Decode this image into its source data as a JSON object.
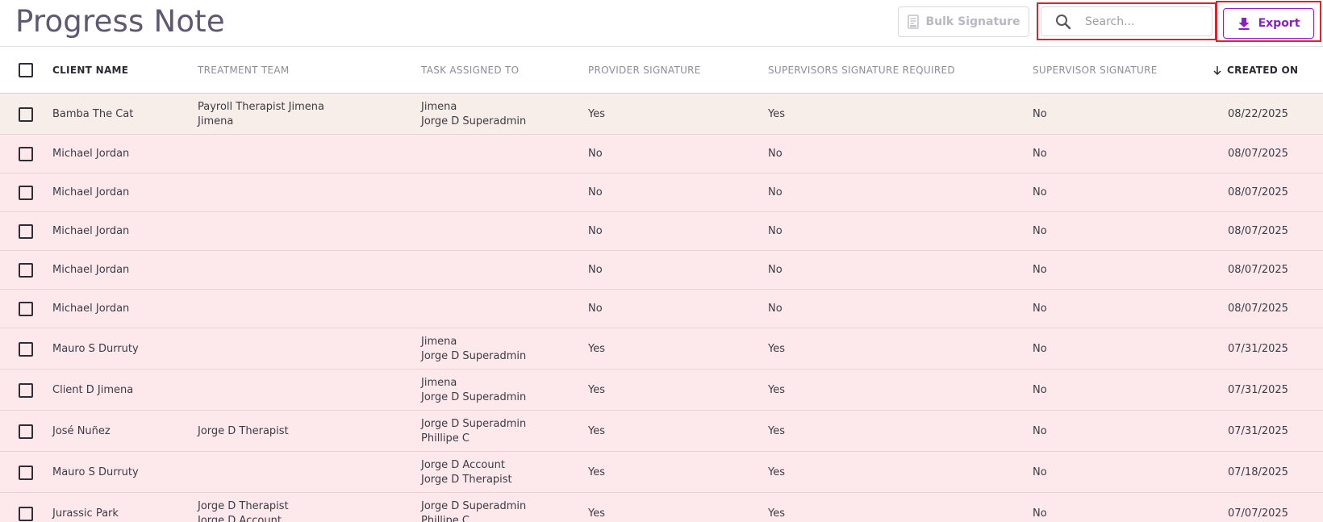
{
  "header": {
    "title": "Progress Note",
    "bulk_signature_label": "Bulk Signature",
    "search_placeholder": "Search...",
    "export_label": "Export",
    "icons": {
      "bulk": "document-signature-icon",
      "search": "search-icon",
      "export": "download-icon"
    },
    "colors": {
      "accent": "#8a1fc9",
      "highlight_outline": "#e0202a",
      "title": "#5f5872"
    }
  },
  "table": {
    "columns": [
      "CLIENT NAME",
      "TREATMENT TEAM",
      "TASK ASSIGNED TO",
      "PROVIDER SIGNATURE",
      "SUPERVISORS SIGNATURE REQUIRED",
      "SUPERVISOR SIGNATURE",
      "CREATED ON"
    ],
    "sorted_column": "CREATED ON",
    "sort_direction": "descending",
    "row_colors": {
      "first": "#f7eeea",
      "rest": "#fde9ec"
    },
    "rows": [
      {
        "client": "Bamba The Cat",
        "team": [
          "Payroll Therapist Jimena",
          "Jimena"
        ],
        "assigned": [
          "Jimena",
          "Jorge D Superadmin"
        ],
        "provider_sig": "Yes",
        "sup_required": "Yes",
        "sup_sig": "No",
        "created": "08/22/2025"
      },
      {
        "client": "Michael Jordan",
        "team": [],
        "assigned": [],
        "provider_sig": "No",
        "sup_required": "No",
        "sup_sig": "No",
        "created": "08/07/2025"
      },
      {
        "client": "Michael Jordan",
        "team": [],
        "assigned": [],
        "provider_sig": "No",
        "sup_required": "No",
        "sup_sig": "No",
        "created": "08/07/2025"
      },
      {
        "client": "Michael Jordan",
        "team": [],
        "assigned": [],
        "provider_sig": "No",
        "sup_required": "No",
        "sup_sig": "No",
        "created": "08/07/2025"
      },
      {
        "client": "Michael Jordan",
        "team": [],
        "assigned": [],
        "provider_sig": "No",
        "sup_required": "No",
        "sup_sig": "No",
        "created": "08/07/2025"
      },
      {
        "client": "Michael Jordan",
        "team": [],
        "assigned": [],
        "provider_sig": "No",
        "sup_required": "No",
        "sup_sig": "No",
        "created": "08/07/2025"
      },
      {
        "client": "Mauro S Durruty",
        "team": [],
        "assigned": [
          "Jimena",
          "Jorge D Superadmin"
        ],
        "provider_sig": "Yes",
        "sup_required": "Yes",
        "sup_sig": "No",
        "created": "07/31/2025"
      },
      {
        "client": "Client D Jimena",
        "team": [],
        "assigned": [
          "Jimena",
          "Jorge D Superadmin"
        ],
        "provider_sig": "Yes",
        "sup_required": "Yes",
        "sup_sig": "No",
        "created": "07/31/2025"
      },
      {
        "client": "José Nuñez",
        "team": [
          "Jorge D Therapist"
        ],
        "assigned": [
          "Jorge D Superadmin",
          "Phillipe C"
        ],
        "provider_sig": "Yes",
        "sup_required": "Yes",
        "sup_sig": "No",
        "created": "07/31/2025"
      },
      {
        "client": "Mauro S Durruty",
        "team": [],
        "assigned": [
          "Jorge D Account",
          "Jorge D Therapist"
        ],
        "provider_sig": "Yes",
        "sup_required": "Yes",
        "sup_sig": "No",
        "created": "07/18/2025"
      },
      {
        "client": "Jurassic Park",
        "team": [
          "Jorge D Therapist",
          "Jorge D Account"
        ],
        "assigned": [
          "Jorge D Superadmin",
          "Phillipe C"
        ],
        "provider_sig": "Yes",
        "sup_required": "Yes",
        "sup_sig": "No",
        "created": "07/07/2025"
      }
    ]
  }
}
